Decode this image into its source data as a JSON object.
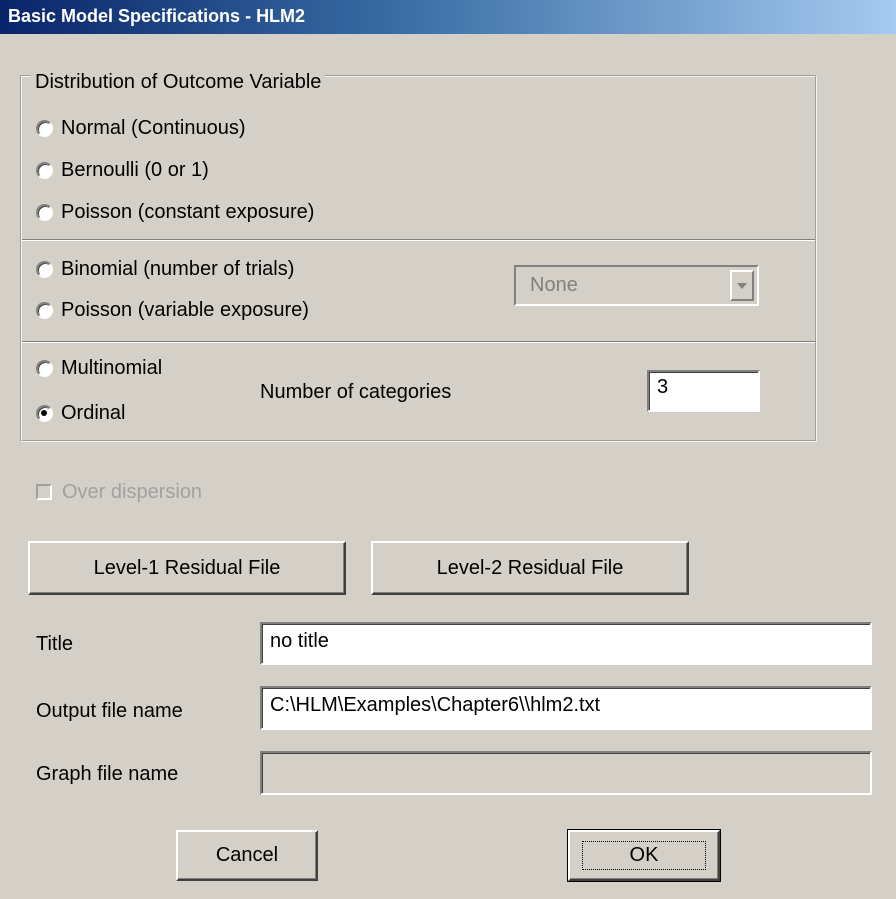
{
  "window": {
    "title": "Basic Model Specifications - HLM2"
  },
  "distribution": {
    "legend": "Distribution of Outcome Variable",
    "options": [
      {
        "label": "Normal (Continuous)",
        "checked": false
      },
      {
        "label": "Bernoulli  (0 or 1)",
        "checked": false
      },
      {
        "label": "Poisson (constant exposure)",
        "checked": false
      },
      {
        "label": "Binomial (number of trials)",
        "checked": false
      },
      {
        "label": "Poisson (variable exposure)",
        "checked": false
      },
      {
        "label": "Multinomial",
        "checked": false
      },
      {
        "label": "Ordinal",
        "checked": true
      }
    ],
    "exposure_select": {
      "value": "None",
      "enabled": false
    },
    "categories_label": "Number of categories",
    "categories_value": "3"
  },
  "over_dispersion": {
    "label": "Over dispersion",
    "checked": false,
    "enabled": false
  },
  "residual_buttons": {
    "level1_label": "Level-1 Residual File",
    "level2_label": "Level-2 Residual File"
  },
  "fields": {
    "title_label": "Title",
    "title_value": "no title",
    "output_label": "Output file name",
    "output_value": "C:\\HLM\\Examples\\Chapter6\\\\hlm2.txt",
    "graph_label": "Graph file name",
    "graph_value": ""
  },
  "actions": {
    "cancel_label": "Cancel",
    "ok_label": "OK"
  }
}
